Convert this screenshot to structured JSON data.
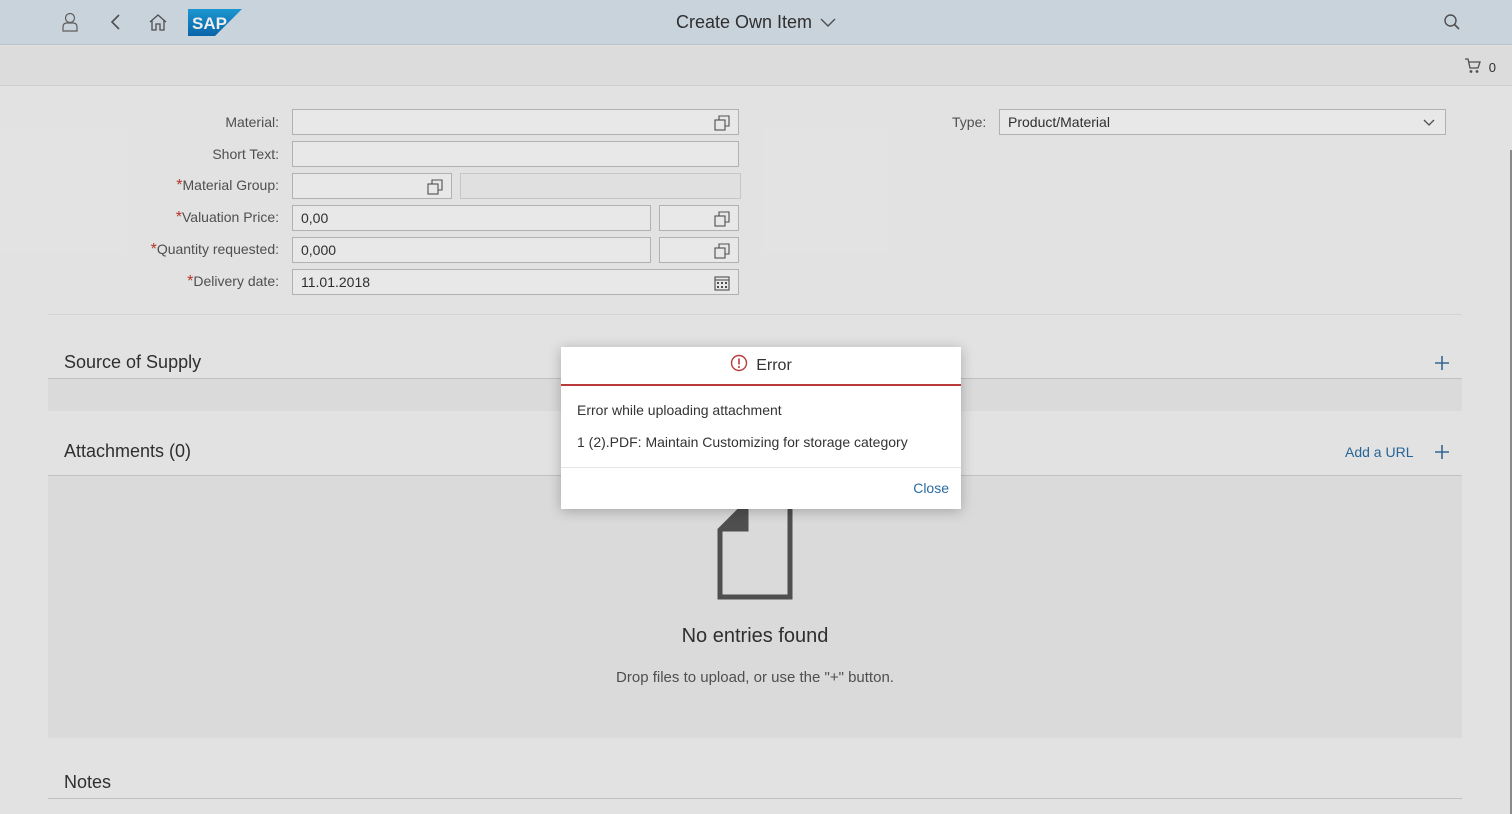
{
  "shell": {
    "title": "Create Own Item",
    "logo_text": "SAP",
    "icons": [
      "user-icon",
      "back-icon",
      "home-icon",
      "search-icon"
    ]
  },
  "subbar": {
    "cart_count": "0"
  },
  "form": {
    "material_label": "Material:",
    "short_text_label": "Short Text:",
    "material_group_label": "Material Group:",
    "valuation_price_label": "Valuation Price:",
    "valuation_price_value": "0,00",
    "quantity_label": "Quantity requested:",
    "quantity_value": "0,000",
    "delivery_date_label": "Delivery date:",
    "delivery_date_value": "11.01.2018",
    "type_label": "Type:",
    "type_value": "Product/Material",
    "required_mark": "*"
  },
  "sections": {
    "source_of_supply": "Source of Supply",
    "attachments": "Attachments (0)",
    "add_url": "Add a URL",
    "notes": "Notes",
    "empty_title": "No entries found",
    "empty_sub": "Drop files to upload, or use the \"+\" button."
  },
  "dialog": {
    "title": "Error",
    "line1": "Error while uploading attachment",
    "line2": "1 (2).PDF: Maintain Customizing for storage category",
    "close_label": "Close"
  },
  "colors": {
    "shell": "#d9e3ec",
    "error": "#b83a3a",
    "link": "#2b6ca3"
  }
}
